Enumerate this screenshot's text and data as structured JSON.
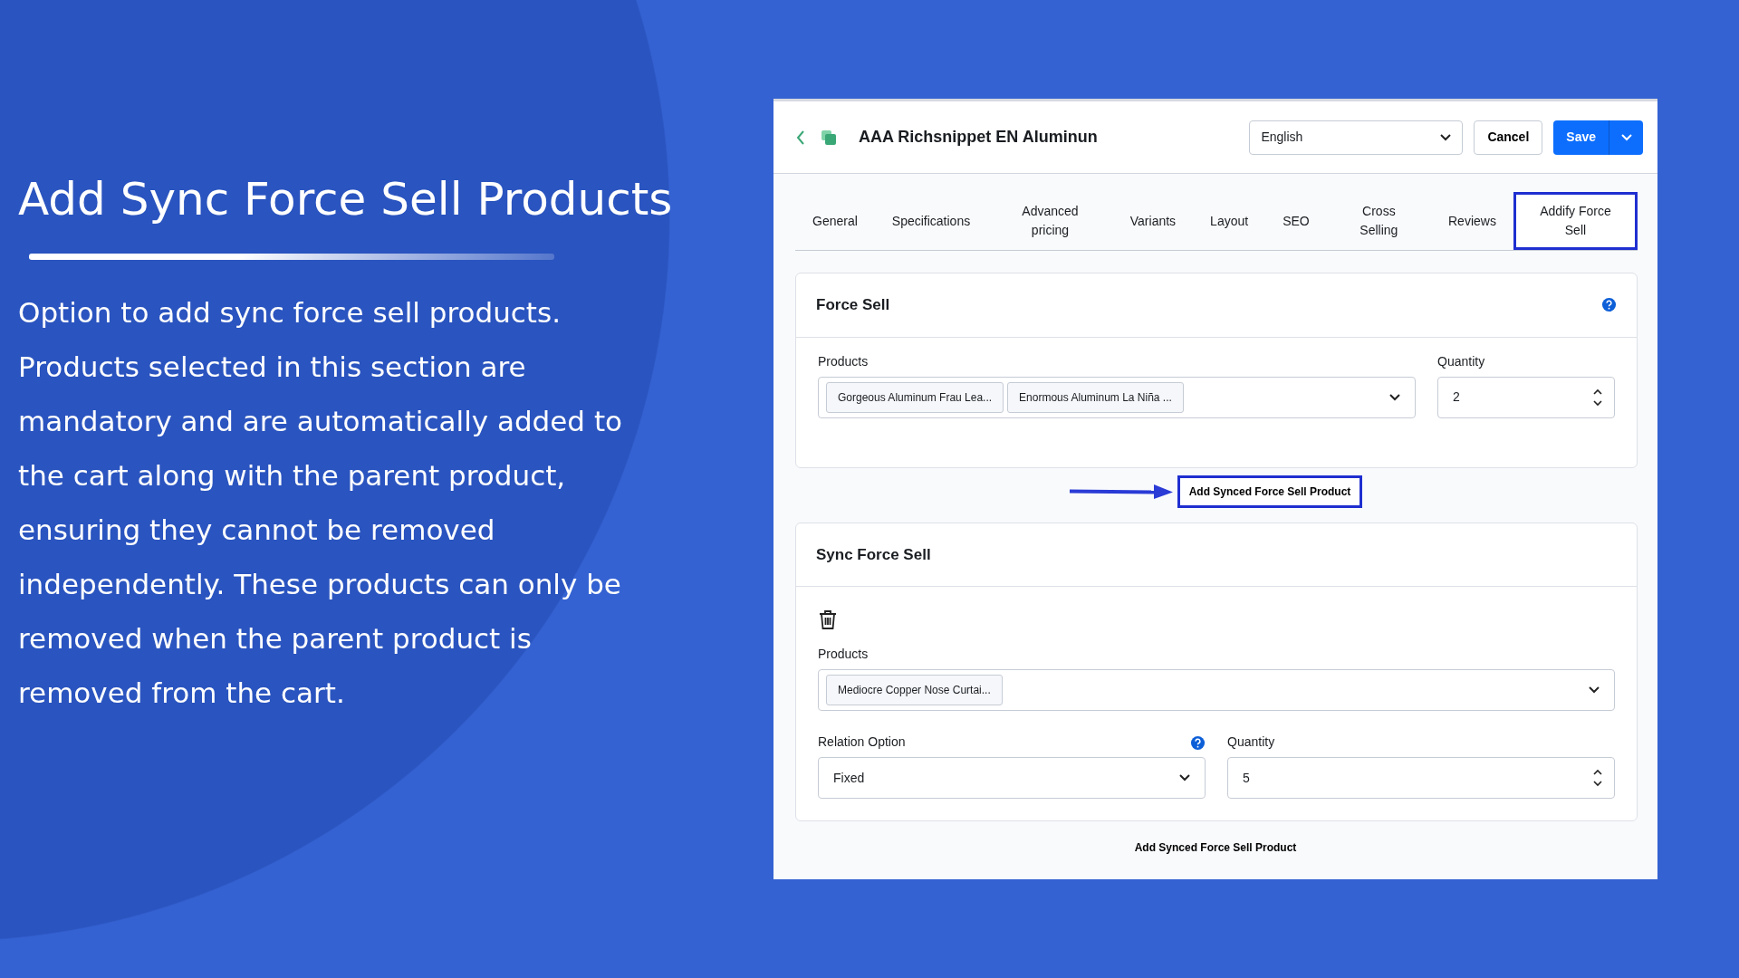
{
  "slide": {
    "heading": "Add Sync Force Sell Products",
    "description": "Option to add sync force sell products. Products selected in this section are mandatory and are automatically added to the cart along with the parent product, ensuring they cannot be removed independently. These products can only be removed when the parent product is removed from the cart."
  },
  "app": {
    "title": "AAA Richsnippet EN Aluminun",
    "language": "English",
    "cancel": "Cancel",
    "save": "Save",
    "tabs": [
      {
        "label": "General",
        "selected": false
      },
      {
        "label": "Specifications",
        "selected": false
      },
      {
        "label": "Advanced pricing",
        "selected": false
      },
      {
        "label": "Variants",
        "selected": false
      },
      {
        "label": "Layout",
        "selected": false
      },
      {
        "label": "SEO",
        "selected": false
      },
      {
        "label": "Cross Selling",
        "selected": false
      },
      {
        "label": "Reviews",
        "selected": false
      },
      {
        "label": "Addify Force Sell",
        "selected": true
      }
    ],
    "force_sell": {
      "title": "Force Sell",
      "products_label": "Products",
      "products": [
        "Gorgeous Aluminum Frau Lea...",
        "Enormous Aluminum La Niña ..."
      ],
      "quantity_label": "Quantity",
      "quantity": "2"
    },
    "add_button": {
      "label": "Add Synced Force Sell Product",
      "highlighted": true
    },
    "sync_force_sell": {
      "title": "Sync Force Sell",
      "products_label": "Products",
      "products": [
        "Mediocre Copper Nose Curtai..."
      ],
      "relation_label": "Relation Option",
      "relation": "Fixed",
      "quantity_label": "Quantity",
      "quantity": "5"
    },
    "footer_link": "Add Synced Force Sell Product"
  }
}
